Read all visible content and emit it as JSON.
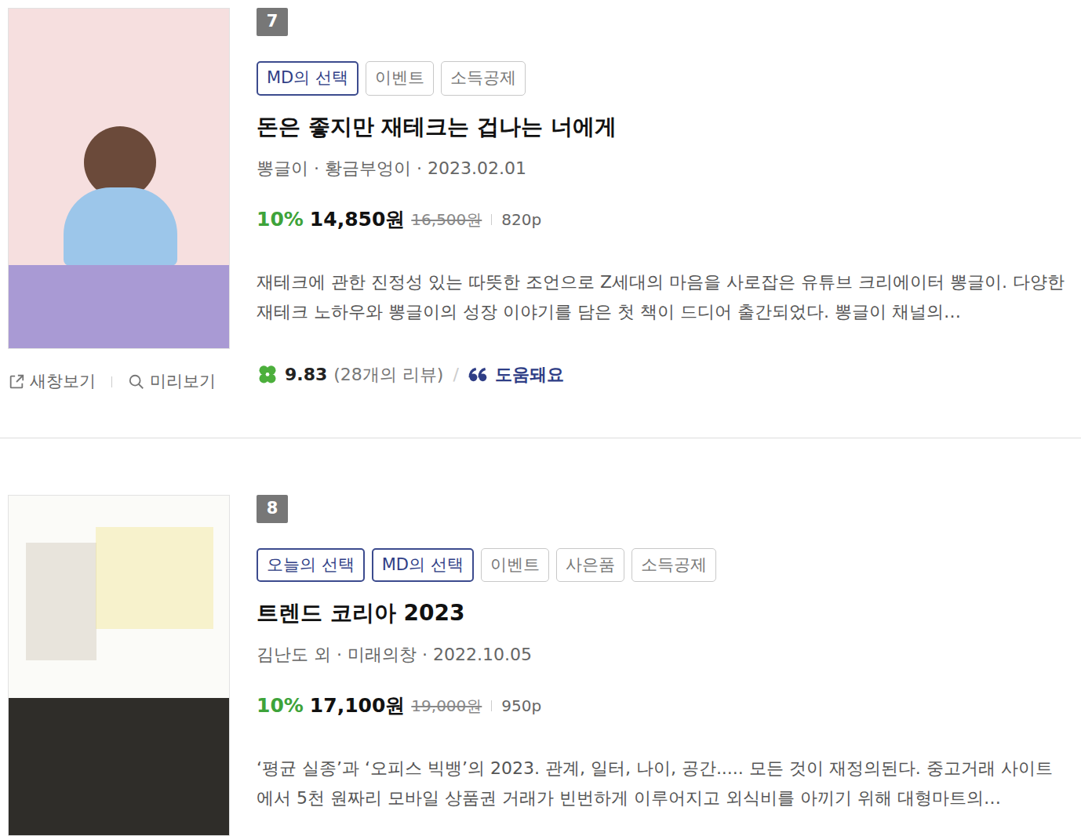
{
  "books": [
    {
      "rank": "7",
      "tags": [
        {
          "label": "MD의 선택",
          "highlighted": true
        },
        {
          "label": "이벤트",
          "highlighted": false
        },
        {
          "label": "소득공제",
          "highlighted": false
        }
      ],
      "title": "돈은 좋지만 재테크는 겁나는 너에게",
      "meta": "뽕글이 · 황금부엉이 · 2023.02.01",
      "discount": "10%",
      "price": "14,850원",
      "original_price": "16,500원",
      "pages": "820p",
      "description": "재테크에 관한 진정성 있는 따뜻한 조언으로 Z세대의 마음을 사로잡은 유튜브 크리에이터 뽕글이. 다양한 재테크 노하우와 뽕글이의 성장 이야기를 담은 첫 책이 드디어 출간되었다. 뽕글이 채널의…",
      "cover": {
        "kind": "pink"
      },
      "actions": [
        "새창보기",
        "미리보기"
      ],
      "rating": {
        "score": "9.83",
        "reviews": "(28개의 리뷰)",
        "separator": "/",
        "helpful": "도움돼요"
      }
    },
    {
      "rank": "8",
      "tags": [
        {
          "label": "오늘의 선택",
          "highlighted": true
        },
        {
          "label": "MD의 선택",
          "highlighted": true
        },
        {
          "label": "이벤트",
          "highlighted": false
        },
        {
          "label": "사은품",
          "highlighted": false
        },
        {
          "label": "소득공제",
          "highlighted": false
        }
      ],
      "title": "트렌드 코리아 2023",
      "meta": "김난도 외 · 미래의창 · 2022.10.05",
      "discount": "10%",
      "price": "17,100원",
      "original_price": "19,000원",
      "pages": "950p",
      "description": "‘평균 실종’과 ‘오피스 빅뱅’의 2023. 관계, 일터, 나이, 공간..... 모든 것이 재정의된다. 중고거래 사이트에서 5천 원짜리 모바일 상품권 거래가 빈번하게 이루어지고 외식비를 아끼기 위해 대형마트의…",
      "cover": {
        "kind": "yellow"
      }
    }
  ]
}
